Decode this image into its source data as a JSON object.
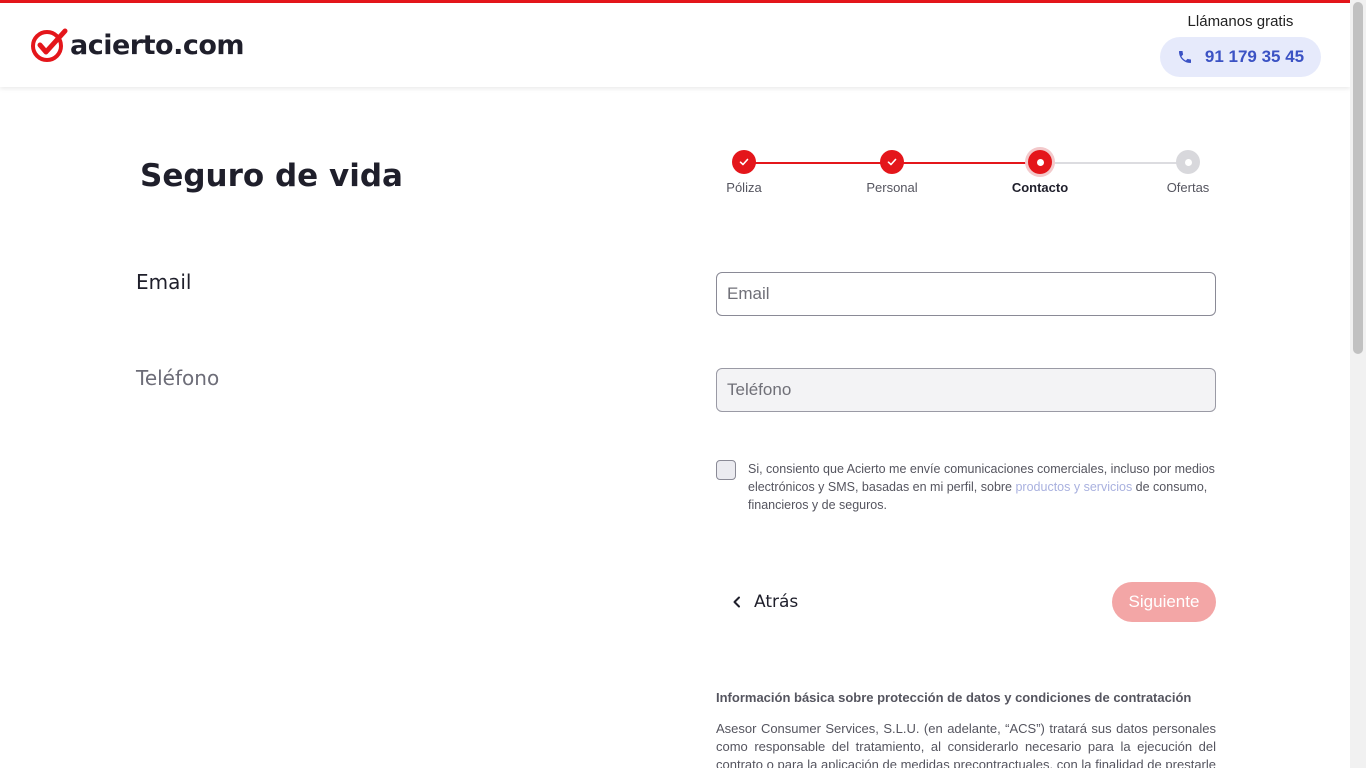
{
  "brand": {
    "logo_text": "acierto.com",
    "accent_color": "#e4161b",
    "link_color": "#3b52c4"
  },
  "header": {
    "call_label": "Llámanos gratis",
    "phone_number": "91 179 35 45"
  },
  "page": {
    "title": "Seguro de vida"
  },
  "stepper": {
    "steps": [
      {
        "label": "Póliza",
        "state": "done"
      },
      {
        "label": "Personal",
        "state": "done"
      },
      {
        "label": "Contacto",
        "state": "current"
      },
      {
        "label": "Ofertas",
        "state": "todo"
      }
    ]
  },
  "form": {
    "email_label": "Email",
    "email_placeholder": "Email",
    "email_value": "",
    "phone_label": "Teléfono",
    "phone_placeholder": "Teléfono",
    "phone_value": "",
    "consent_checked": false,
    "consent_text_before": "Si, consiento que Acierto me envíe comunicaciones comerciales, incluso por medios electrónicos y SMS, basadas en mi perfil, sobre ",
    "consent_link": "productos y servicios",
    "consent_text_after": " de consumo, financieros y de seguros."
  },
  "actions": {
    "back_label": "Atrás",
    "next_label": "Siguiente"
  },
  "legal": {
    "title": "Información básica sobre protección de datos y condiciones de contratación",
    "text": "Asesor Consumer Services, S.L.U. (en adelante, “ACS”) tratará sus datos personales como responsable del tratamiento, al considerarlo necesario para la ejecución del contrato o para la aplicación de medidas precontractuales, con la finalidad de prestarle los servicios"
  }
}
